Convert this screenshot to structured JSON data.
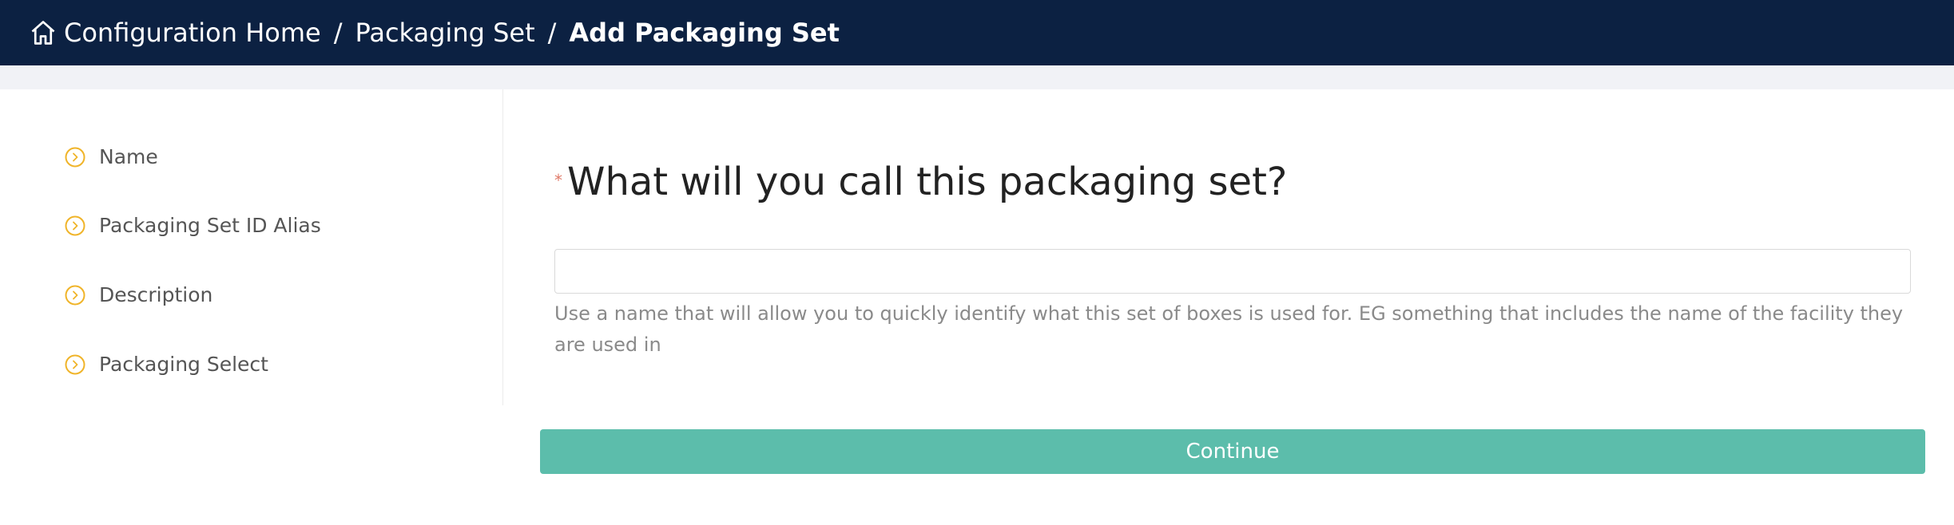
{
  "breadcrumb": {
    "home": "Configuration Home",
    "separator": "/",
    "section": "Packaging Set",
    "current": "Add Packaging Set"
  },
  "sidebar": {
    "items": [
      {
        "label": "Name",
        "icon": "chevron-right-circle-icon"
      },
      {
        "label": "Packaging Set ID Alias",
        "icon": "chevron-right-circle-icon"
      },
      {
        "label": "Description",
        "icon": "chevron-right-circle-icon"
      },
      {
        "label": "Packaging Select",
        "icon": "chevron-right-circle-icon"
      }
    ]
  },
  "form": {
    "required_marker": "*",
    "question": "What will you call this packaging set?",
    "input_value": "",
    "input_placeholder": "",
    "help_text": "Use a name that will allow you to quickly identify what this set of boxes is used for. EG something that includes the name of the facility they are used in",
    "continue_label": "Continue"
  },
  "colors": {
    "header_bg": "#0c2142",
    "accent": "#5cbdab",
    "step_icon": "#f0b429",
    "required": "#e07b6a"
  }
}
